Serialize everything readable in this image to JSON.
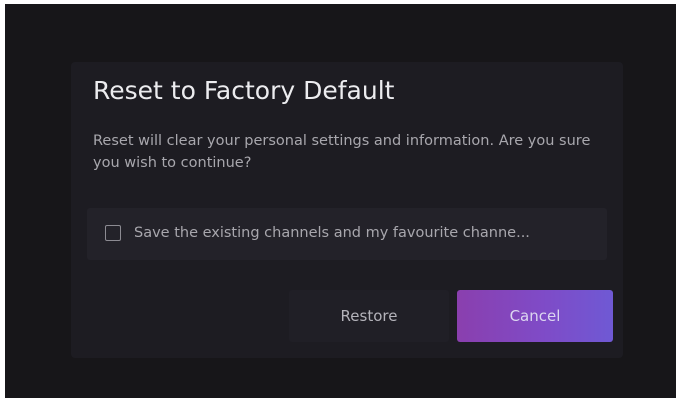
{
  "dialog": {
    "title": "Reset to Factory Default",
    "message": "Reset will clear your personal settings and information. Are you sure you wish to continue?",
    "option": {
      "label": "Save the existing channels and my favourite channe...",
      "checked": false
    },
    "buttons": {
      "restore_label": "Restore",
      "cancel_label": "Cancel"
    }
  },
  "colors": {
    "background": "#171619",
    "dialog": "#1d1c22",
    "accent_start": "#8a3fae",
    "accent_end": "#6f59d4"
  }
}
